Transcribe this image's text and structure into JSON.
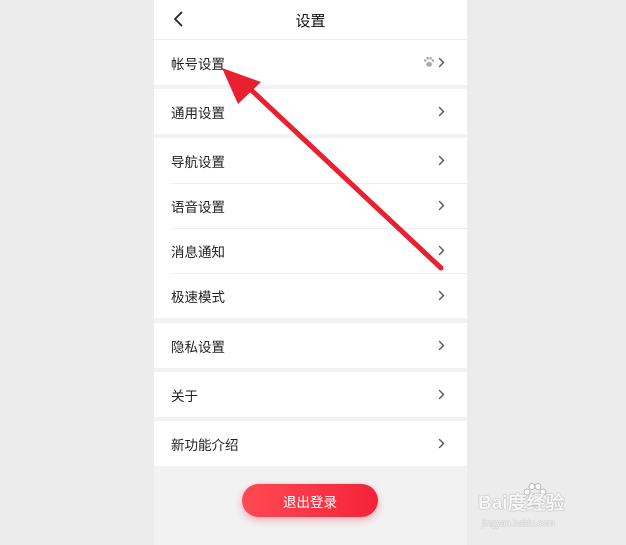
{
  "header": {
    "title": "设置",
    "back_icon": "chevron-left-icon"
  },
  "groups": [
    {
      "items": [
        {
          "label": "帐号设置",
          "icon": "paw-icon"
        }
      ]
    },
    {
      "items": [
        {
          "label": "通用设置"
        }
      ]
    },
    {
      "items": [
        {
          "label": "导航设置"
        },
        {
          "label": "语音设置"
        },
        {
          "label": "消息通知"
        },
        {
          "label": "极速模式"
        }
      ]
    },
    {
      "items": [
        {
          "label": "隐私设置"
        }
      ]
    },
    {
      "items": [
        {
          "label": "关于"
        }
      ]
    },
    {
      "items": [
        {
          "label": "新功能介绍"
        }
      ]
    }
  ],
  "logout_label": "退出登录",
  "watermark": {
    "brand": "Bai度经验",
    "site": "jingyan.baidu.com"
  },
  "colors": {
    "accent": "#f3233a",
    "annotation_arrow": "#e8202f"
  }
}
